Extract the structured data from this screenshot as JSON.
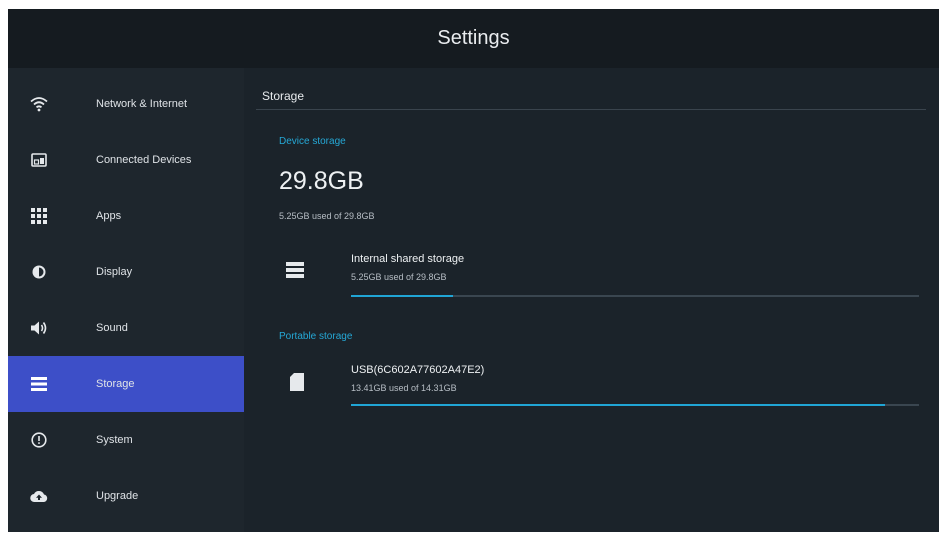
{
  "window": {
    "title": "Settings"
  },
  "sidebar": {
    "active_index": 5,
    "items": [
      {
        "label": "Network & Internet",
        "icon": "wifi-icon"
      },
      {
        "label": "Connected Devices",
        "icon": "devices-icon"
      },
      {
        "label": "Apps",
        "icon": "apps-grid-icon"
      },
      {
        "label": "Display",
        "icon": "brightness-icon"
      },
      {
        "label": "Sound",
        "icon": "volume-icon"
      },
      {
        "label": "Storage",
        "icon": "storage-icon"
      },
      {
        "label": "System",
        "icon": "info-icon"
      },
      {
        "label": "Upgrade",
        "icon": "cloud-upload-icon"
      }
    ]
  },
  "storage": {
    "title": "Storage",
    "device_storage": {
      "group_label": "Device storage",
      "total": "29.8GB",
      "summary": "5.25GB used of 29.8GB",
      "internal": {
        "name": "Internal shared storage",
        "usage": "5.25GB used of 29.8GB",
        "used_fraction": 0.18,
        "icon": "storage-icon"
      }
    },
    "portable_storage": {
      "group_label": "Portable storage",
      "usb": {
        "name": "USB(6C602A77602A47E2)",
        "usage": "13.41GB used of 14.31GB",
        "used_fraction": 0.94,
        "icon": "sd-card-icon"
      }
    }
  },
  "colors": {
    "accent": "#20a5d5",
    "active_item": "#3d4fc8",
    "background": "#1b232a"
  }
}
